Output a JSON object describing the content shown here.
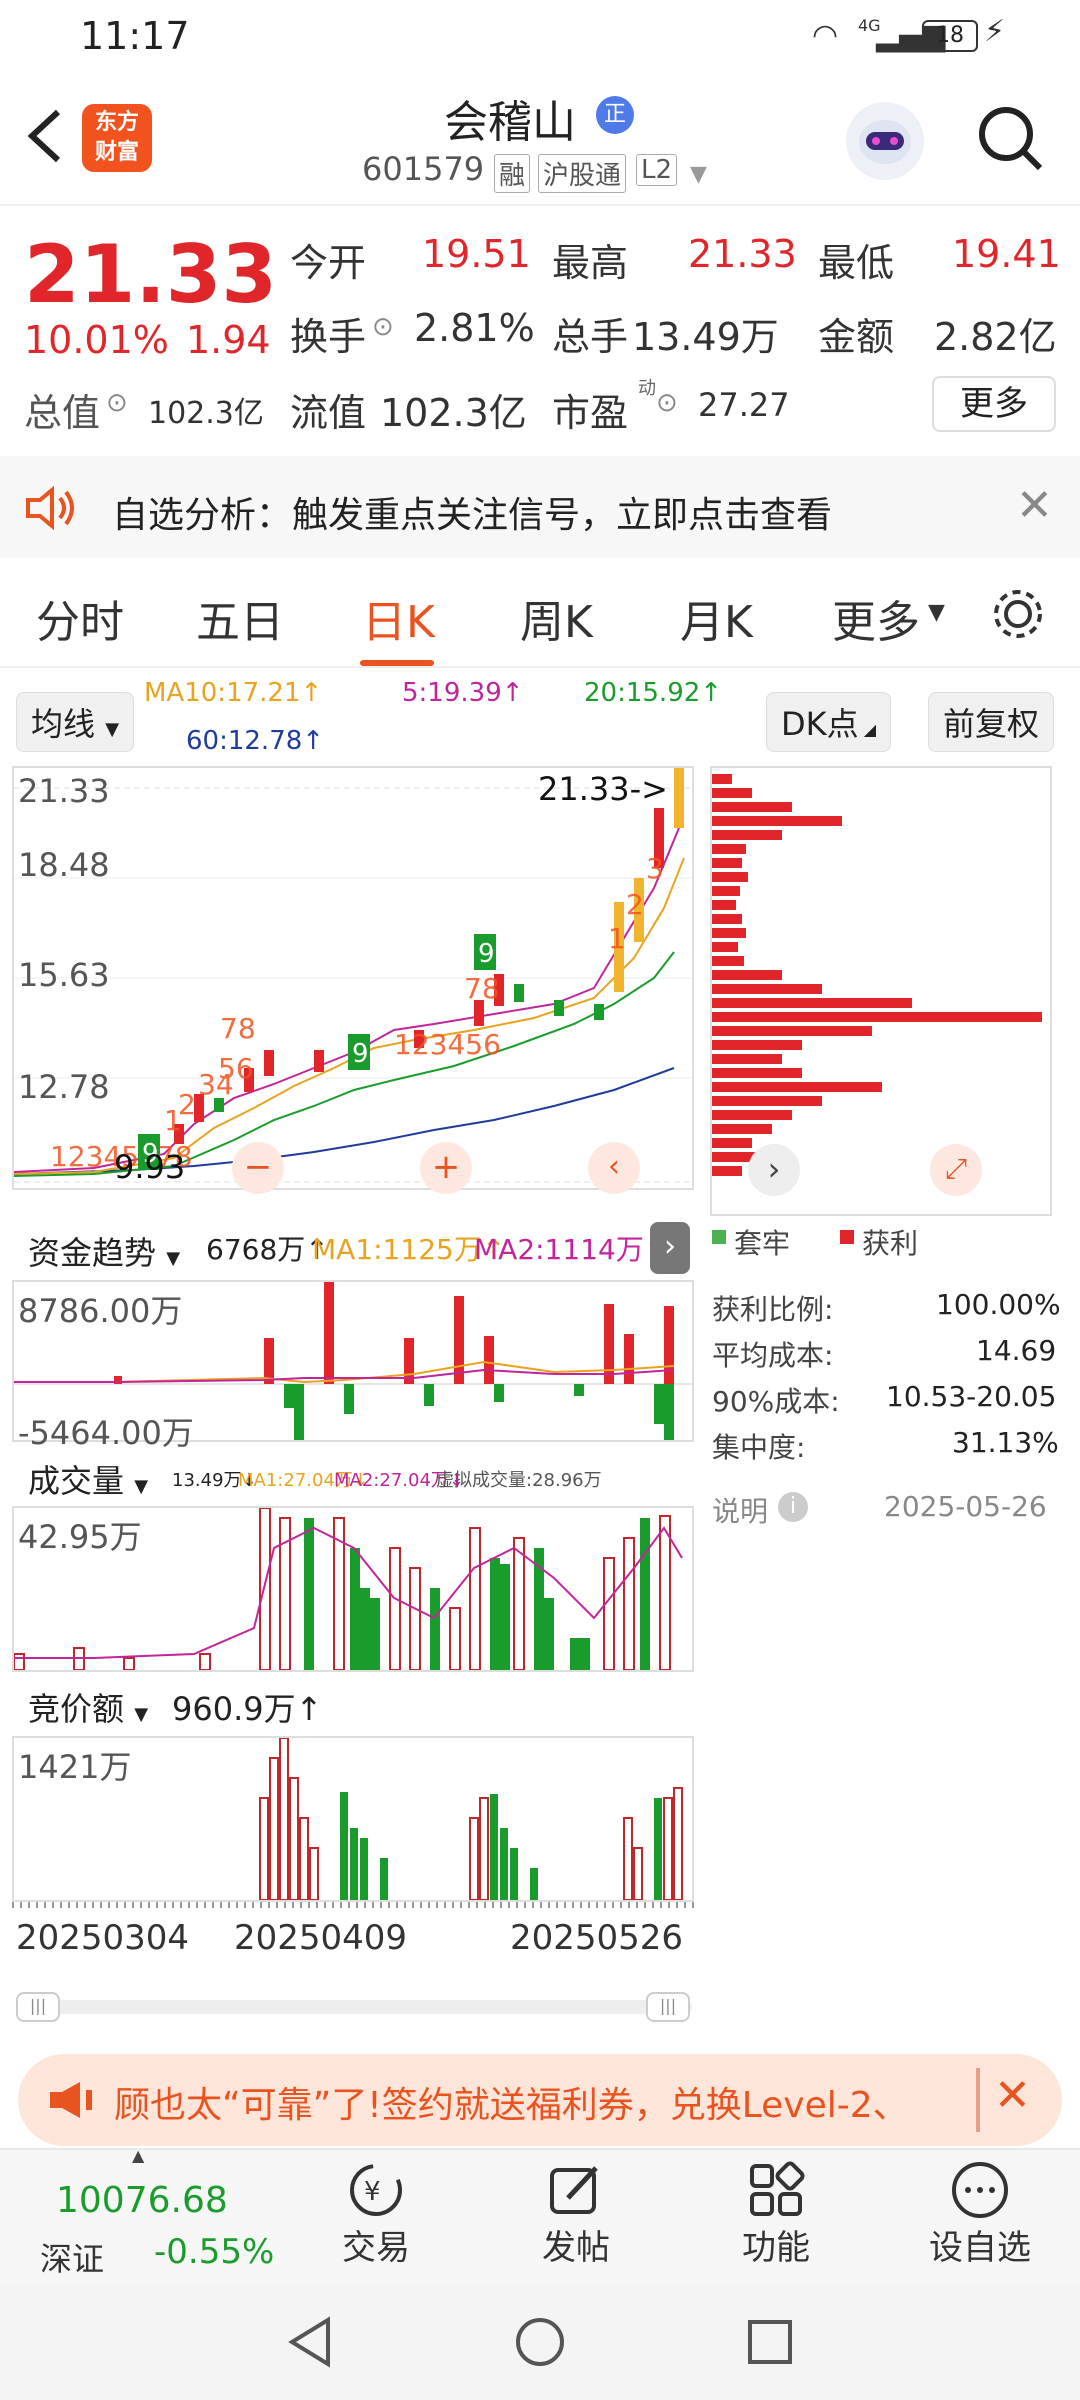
{
  "status": {
    "time": "11:17",
    "battery": "18",
    "network": "4G"
  },
  "header": {
    "back_icon": "back-arrow-icon",
    "logo_line1": "东方",
    "logo_line2": "财富",
    "stock_name": "会稽山",
    "badge": "正",
    "code": "601579",
    "tags": [
      "融",
      "沪股通",
      "L2"
    ]
  },
  "quote": {
    "price": "21.33",
    "pct": "10.01%",
    "change": "1.94",
    "row1": [
      {
        "k": "今开",
        "v": "19.51"
      },
      {
        "k": "最高",
        "v": "21.33"
      },
      {
        "k": "最低",
        "v": "19.41"
      }
    ],
    "row2": [
      {
        "k": "换手",
        "v": "2.81%"
      },
      {
        "k": "总手",
        "v": "13.49万"
      },
      {
        "k": "金额",
        "v": "2.82亿"
      }
    ],
    "row3": [
      {
        "k": "总值",
        "v": "102.3亿"
      },
      {
        "k": "流值",
        "v": "102.3亿"
      },
      {
        "k": "市盈",
        "v": "27.27",
        "sup": "动"
      }
    ],
    "more": "更多"
  },
  "banner": {
    "text": "自选分析：触发重点关注信号，立即点击查看"
  },
  "tabs": [
    "分时",
    "五日",
    "日K",
    "周K",
    "月K",
    "更多",
    "settings"
  ],
  "active_tab": 2,
  "ma": {
    "selector": "均线",
    "ma10": "MA10:17.21↑",
    "ma5": "5:19.39↑",
    "ma20": "20:15.92↑",
    "ma60": "60:12.78↑",
    "dk": "DK点",
    "fq": "前复权"
  },
  "kline": {
    "yticks": [
      "21.33",
      "18.48",
      "15.63",
      "12.78"
    ],
    "high_marker": "21.33->",
    "low_marker": "9.93"
  },
  "chips": {
    "legend": [
      "套牢",
      "获利"
    ],
    "rows": [
      {
        "k": "获利比例:",
        "v": "100.00%"
      },
      {
        "k": "平均成本:",
        "v": "14.69"
      },
      {
        "k": "90%成本:",
        "v": "10.53-20.05"
      },
      {
        "k": "集中度:",
        "v": "31.13%"
      }
    ],
    "note": "说明",
    "date": "2025-05-26"
  },
  "fund": {
    "title": "资金趋势",
    "value": "6768万↑",
    "ma1": "MA1:1125万↑",
    "ma2": "MA2:1114万↑",
    "top": "8786.00万",
    "bottom": "-5464.00万"
  },
  "vol": {
    "title": "成交量",
    "value": "13.49万↓",
    "ma1": "MA1:27.04万↓",
    "ma2": "MA2:27.04万↓",
    "virt": "虚拟成交量:28.96万",
    "top": "42.95万"
  },
  "auction": {
    "title": "竞价额",
    "value": "960.9万↑",
    "top": "1421万"
  },
  "dates": [
    "20250304",
    "20250409",
    "20250526"
  ],
  "promo": {
    "text": "顾也太“可靠”了!签约就送福利券，兑换Level-2、"
  },
  "bottom": {
    "index_value": "10076.68",
    "index_name": "深证",
    "index_pct": "-0.55%",
    "items": [
      "交易",
      "发帖",
      "功能",
      "设自选"
    ]
  }
}
